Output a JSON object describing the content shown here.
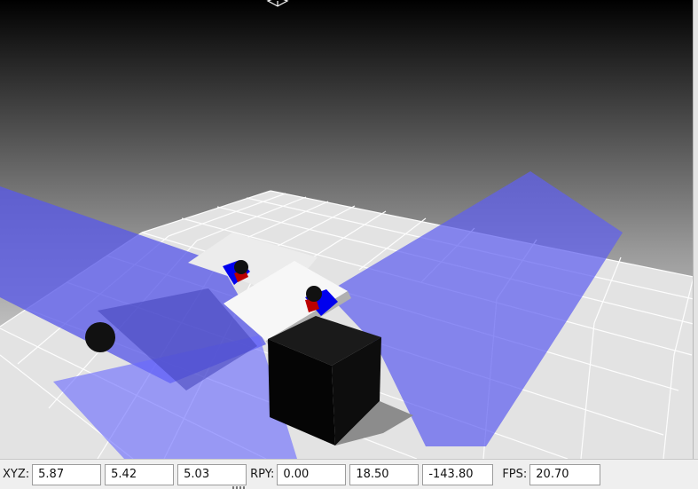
{
  "status_bar": {
    "xyz_label": "XYZ:",
    "xyz": [
      "5.87",
      "5.42",
      "5.03"
    ],
    "rpy_label": "RPY:",
    "rpy": [
      "0.00",
      "18.50",
      "-143.80"
    ],
    "fps_label": "FPS:",
    "fps": "20.70"
  },
  "colors": {
    "sky_top": "#000000",
    "sky_bottom": "#ffffff",
    "ground": "#e6e6e6",
    "sensor_plane": "#6666ff",
    "box_dark": "#0c0c0c",
    "marker_blue": "#0000ff",
    "marker_red": "#cc0000"
  }
}
